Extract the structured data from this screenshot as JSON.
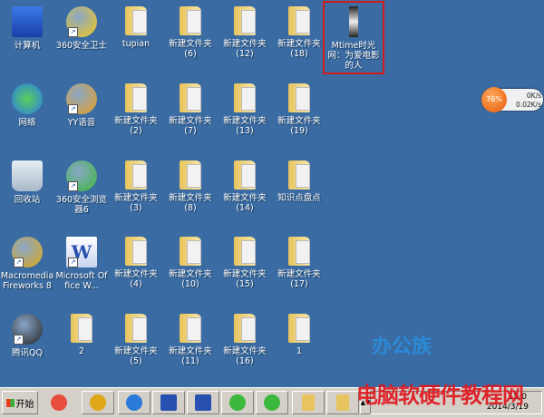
{
  "desktop": {
    "rows": [
      [
        {
          "label": "计算机",
          "kind": "computer"
        },
        {
          "label": "360安全卫士",
          "kind": "app",
          "shortcut": true,
          "color": "#f2c81c"
        },
        {
          "label": "tupian",
          "kind": "folder"
        },
        {
          "label": "新建文件夹\n(6)",
          "kind": "folder"
        },
        {
          "label": "新建文件夹\n(12)",
          "kind": "folder"
        },
        {
          "label": "新建文件夹\n(18)",
          "kind": "folder"
        },
        {
          "label": "Mtime时光网：为爱电影的人",
          "kind": "file",
          "selected": true
        }
      ],
      [
        {
          "label": "网络",
          "kind": "network"
        },
        {
          "label": "YY语音",
          "kind": "app",
          "shortcut": true,
          "color": "#e8a020"
        },
        {
          "label": "新建文件夹\n(2)",
          "kind": "folder"
        },
        {
          "label": "新建文件夹\n(7)",
          "kind": "folder"
        },
        {
          "label": "新建文件夹\n(13)",
          "kind": "folder"
        },
        {
          "label": "新建文件夹\n(19)",
          "kind": "folder"
        }
      ],
      [
        {
          "label": "回收站",
          "kind": "recycle"
        },
        {
          "label": "360安全浏览器6",
          "kind": "app",
          "shortcut": true,
          "color": "#3cb83c"
        },
        {
          "label": "新建文件夹\n(3)",
          "kind": "folder"
        },
        {
          "label": "新建文件夹\n(8)",
          "kind": "folder"
        },
        {
          "label": "新建文件夹\n(14)",
          "kind": "folder"
        },
        {
          "label": "知识点盘点",
          "kind": "folder"
        }
      ],
      [
        {
          "label": "Macromedia Fireworks 8",
          "kind": "app",
          "shortcut": true,
          "color": "#e0a818"
        },
        {
          "label": "Microsoft Office W...",
          "kind": "word",
          "shortcut": true
        },
        {
          "label": "新建文件夹\n(4)",
          "kind": "folder"
        },
        {
          "label": "新建文件夹\n(10)",
          "kind": "folder"
        },
        {
          "label": "新建文件夹\n(15)",
          "kind": "folder"
        },
        {
          "label": "新建文件夹\n(17)",
          "kind": "folder"
        }
      ],
      [
        {
          "label": "腾讯QQ",
          "kind": "app",
          "shortcut": true,
          "color": "#222"
        },
        {
          "label": "2",
          "kind": "folder"
        },
        {
          "label": "新建文件夹\n(5)",
          "kind": "folder"
        },
        {
          "label": "新建文件夹\n(11)",
          "kind": "folder"
        },
        {
          "label": "新建文件夹\n(16)",
          "kind": "folder"
        },
        {
          "label": "1",
          "kind": "folder"
        }
      ]
    ]
  },
  "speed_widget": {
    "percent": "76%",
    "upload": "0K/s",
    "download": "0.02K/s"
  },
  "taskbar": {
    "start_label": "开始",
    "buttons": [
      {
        "name": "360-launcher",
        "color": "#e84c3c"
      },
      {
        "name": "fireworks",
        "color": "#e0a818"
      },
      {
        "name": "internet-explorer",
        "color": "#2a7ad8"
      },
      {
        "name": "word-1",
        "color": "#2850b0"
      },
      {
        "name": "word-2",
        "color": "#2850b0"
      },
      {
        "name": "360-browser-1",
        "color": "#3cb83c"
      },
      {
        "name": "360-browser-2",
        "color": "#3cb83c"
      },
      {
        "name": "folder-1",
        "color": "#e8c45e"
      },
      {
        "name": "folder-2",
        "color": "#e8c45e"
      }
    ],
    "clock_time": "15:0",
    "clock_date": "2014/3/19"
  },
  "watermarks": {
    "top": "办公族",
    "bottom": "电脑软硬件教程网"
  }
}
